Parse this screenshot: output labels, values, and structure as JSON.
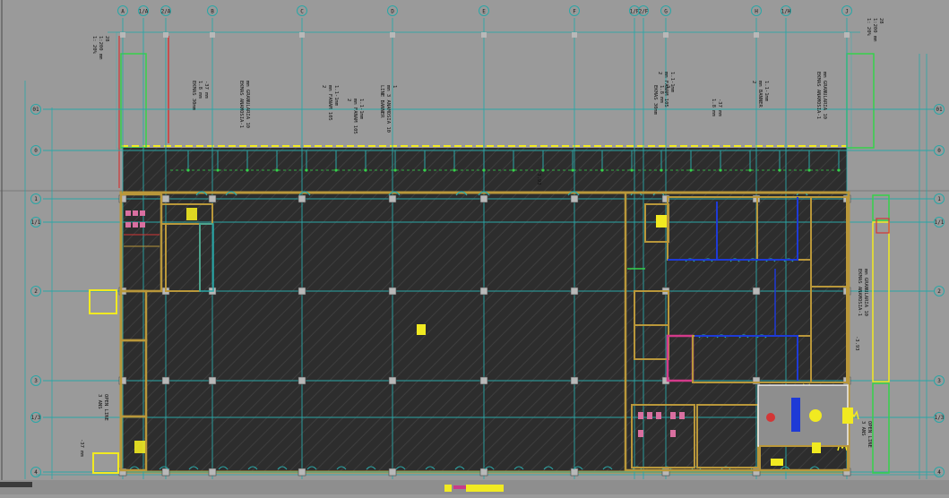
{
  "drawing": {
    "background": "#9a9a9a",
    "floor_fill": "#2d2d2d",
    "colors": {
      "grid": "#2aa7a7",
      "wall": "#b9973a",
      "yellow": "#f1ea21",
      "green": "#35d24b",
      "blue": "#1e3ad6",
      "magenta": "#c83a8a",
      "red": "#d33636",
      "white": "#eeeeee",
      "column": "#b8b8b8"
    },
    "grid_columns": [
      {
        "id": "a",
        "label": "A"
      },
      {
        "id": "a1",
        "label": "1/A"
      },
      {
        "id": "a2",
        "label": "2/A"
      },
      {
        "id": "b",
        "label": "B"
      },
      {
        "id": "c",
        "label": "C"
      },
      {
        "id": "d",
        "label": "D"
      },
      {
        "id": "e",
        "label": "E"
      },
      {
        "id": "f",
        "label": "F"
      },
      {
        "id": "f1",
        "label": "1/F"
      },
      {
        "id": "f2",
        "label": "2/F"
      },
      {
        "id": "g",
        "label": "G"
      },
      {
        "id": "h",
        "label": "H"
      },
      {
        "id": "h1",
        "label": "1/H"
      },
      {
        "id": "j",
        "label": "J"
      }
    ],
    "grid_rows": [
      {
        "id": "r01",
        "label": "01"
      },
      {
        "id": "r0",
        "label": "0"
      },
      {
        "id": "r1",
        "label": "1"
      },
      {
        "id": "r11",
        "label": "1/1"
      },
      {
        "id": "r2",
        "label": "2"
      },
      {
        "id": "r3",
        "label": "3"
      },
      {
        "id": "r31",
        "label": "1/3"
      },
      {
        "id": "r4",
        "label": "4"
      }
    ],
    "notes": [
      {
        "id": "n1",
        "lines": [
          "1: 20%",
          "1:200 mm",
          "28"
        ]
      },
      {
        "id": "n2",
        "lines": [
          "EKMAS 30mm",
          "1.8 mm",
          "-37 mm"
        ]
      },
      {
        "id": "n3",
        "lines": [
          "EKMAS ANAMOSIA-1",
          "mm GRANULARIA 10"
        ]
      },
      {
        "id": "n4",
        "lines": [
          "2",
          "mm FANAM 105",
          "1.1-1mm"
        ]
      },
      {
        "id": "n5",
        "lines": [
          "LINE BANNER",
          "mm 3 ANAMOSIA 10",
          "1"
        ]
      },
      {
        "id": "n6",
        "lines": [
          "2",
          "mm FANAM 105",
          "1.1-1mm"
        ]
      },
      {
        "id": "n7",
        "lines": [
          "EKMAS 30mm",
          "1.8 mm",
          "3"
        ]
      },
      {
        "id": "n8",
        "lines": [
          "1.8 mm",
          "-37 mm"
        ]
      },
      {
        "id": "n9",
        "lines": [
          "2",
          "mm BANNER",
          "1.1-1mm"
        ]
      },
      {
        "id": "n10",
        "lines": [
          "EKMAS ANAMOSIA-1",
          "mm GRANULARIA 10"
        ]
      },
      {
        "id": "n11",
        "lines": [
          "1: 20%",
          "1:200 mm",
          "28"
        ]
      },
      {
        "id": "n12",
        "lines": [
          "2",
          "mm FANAM 105",
          "1.1-1mm"
        ]
      },
      {
        "id": "n13",
        "lines": [
          "EKMAS ANAMOSIA-1",
          "mm GRANULARIA 10"
        ]
      },
      {
        "id": "n14",
        "lines": [
          "3 ANS",
          "OPEN LINE"
        ]
      },
      {
        "id": "n15",
        "lines": [
          "3 ANS",
          "OPEN LINE"
        ]
      },
      {
        "id": "n16",
        "lines": [
          "-37 mm"
        ]
      },
      {
        "id": "n17",
        "lines": [
          "-3.93"
        ]
      },
      {
        "id": "n18",
        "lines": [
          "-3.93"
        ]
      }
    ]
  }
}
